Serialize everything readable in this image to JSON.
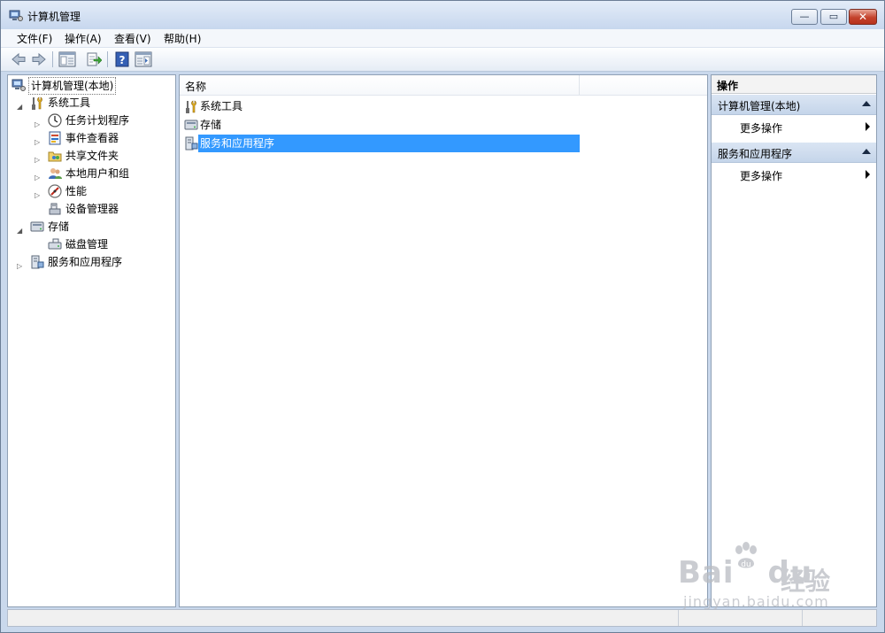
{
  "window": {
    "title": "计算机管理",
    "controls": {
      "minimize": "—",
      "maximize": "▭",
      "close": "✕"
    }
  },
  "menu": [
    "文件(F)",
    "操作(A)",
    "查看(V)",
    "帮助(H)"
  ],
  "toolbar": {
    "icons": [
      "back-arrow-icon",
      "forward-arrow-icon",
      "show-hide-tree-icon",
      "export-list-icon",
      "help-icon",
      "show-hide-action-pane-icon"
    ]
  },
  "tree": {
    "root": "计算机管理(本地)",
    "items": [
      {
        "label": "系统工具",
        "level": 1,
        "expander": "expanded",
        "icon": "tools-icon"
      },
      {
        "label": "任务计划程序",
        "level": 2,
        "expander": "collapsed",
        "icon": "clock-icon"
      },
      {
        "label": "事件查看器",
        "level": 2,
        "expander": "collapsed",
        "icon": "event-viewer-icon"
      },
      {
        "label": "共享文件夹",
        "level": 2,
        "expander": "collapsed",
        "icon": "shared-folder-icon"
      },
      {
        "label": "本地用户和组",
        "level": 2,
        "expander": "collapsed",
        "icon": "users-icon"
      },
      {
        "label": "性能",
        "level": 2,
        "expander": "collapsed",
        "icon": "performance-icon"
      },
      {
        "label": "设备管理器",
        "level": 2,
        "expander": "none",
        "icon": "device-manager-icon"
      },
      {
        "label": "存储",
        "level": 1,
        "expander": "expanded",
        "icon": "storage-icon"
      },
      {
        "label": "磁盘管理",
        "level": 2,
        "expander": "none",
        "icon": "disk-icon"
      },
      {
        "label": "服务和应用程序",
        "level": 1,
        "expander": "collapsed",
        "icon": "services-icon"
      }
    ]
  },
  "list": {
    "column": "名称",
    "items": [
      {
        "label": "系统工具",
        "icon": "tools-icon",
        "selected": false
      },
      {
        "label": "存储",
        "icon": "storage-icon",
        "selected": false
      },
      {
        "label": "服务和应用程序",
        "icon": "services-icon",
        "selected": true
      }
    ]
  },
  "actions": {
    "header": "操作",
    "groups": [
      {
        "title": "计算机管理(本地)",
        "item": "更多操作"
      },
      {
        "title": "服务和应用程序",
        "item": "更多操作"
      }
    ]
  },
  "watermark": {
    "brand": "Bai",
    "brand2": "du",
    "cn": "经验",
    "url": "jingyan.baidu.com"
  },
  "colors": {
    "selection": "#3399ff",
    "frame": "#c9d8ec",
    "close": "#c4422c"
  }
}
